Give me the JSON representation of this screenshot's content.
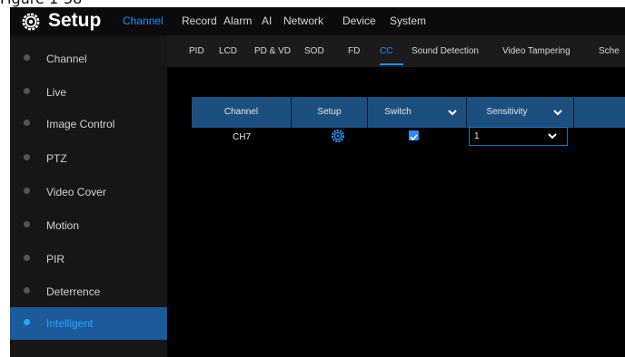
{
  "caption": "Figure 1-38",
  "header": {
    "title": "Setup",
    "tabs": [
      {
        "label": "Channel",
        "active": true
      },
      {
        "label": "Record"
      },
      {
        "label": "Alarm"
      },
      {
        "label": "AI"
      },
      {
        "label": "Network"
      },
      {
        "label": "Device"
      },
      {
        "label": "System"
      }
    ]
  },
  "sidebar": {
    "items": [
      {
        "label": "Channel"
      },
      {
        "label": "Live"
      },
      {
        "label": "Image Control"
      },
      {
        "label": "PTZ"
      },
      {
        "label": "Video Cover"
      },
      {
        "label": "Motion"
      },
      {
        "label": "PIR"
      },
      {
        "label": "Deterrence"
      },
      {
        "label": "Intelligent",
        "active": true
      }
    ]
  },
  "subtabs": [
    {
      "label": "PID"
    },
    {
      "label": "LCD"
    },
    {
      "label": "PD & VD"
    },
    {
      "label": "SOD"
    },
    {
      "label": "FD"
    },
    {
      "label": "CC",
      "active": true
    },
    {
      "label": "Sound Detection"
    },
    {
      "label": "Video Tampering"
    },
    {
      "label": "Sche"
    }
  ],
  "table": {
    "columns": [
      "Channel",
      "Setup",
      "Switch",
      "Sensitivity"
    ],
    "rows": [
      {
        "channel": "CH7",
        "switch_checked": true,
        "sensitivity": "1"
      }
    ]
  },
  "colors": {
    "accent": "#1e90ff",
    "table_header": "#1d4f7e",
    "sidebar_active": "#1b5b9a"
  },
  "icons": {
    "logo": "gear-icon",
    "setup_cell": "gear-icon",
    "dropdown": "chevron-down-icon",
    "sidebar_bullet": "dot-icon"
  }
}
